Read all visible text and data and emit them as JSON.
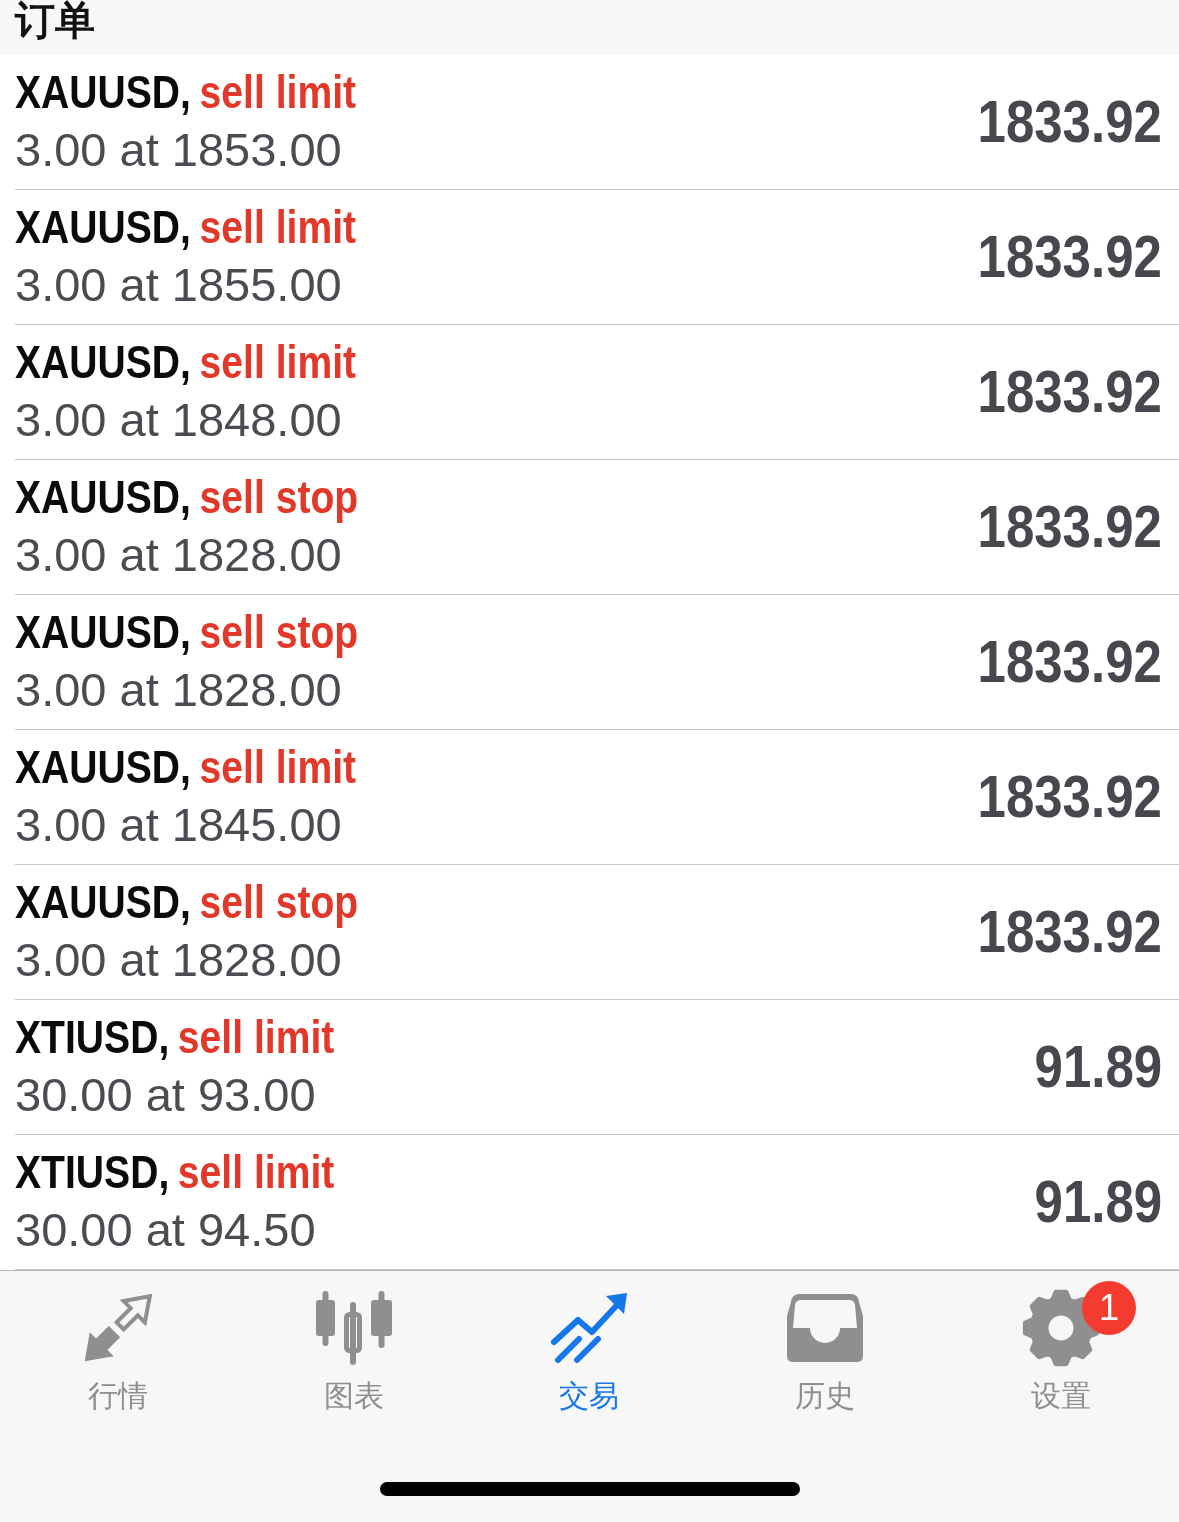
{
  "header": {
    "title": "订单"
  },
  "orders": [
    {
      "symbol": "XAUUSD,",
      "order_type": "sell limit",
      "details": "3.00 at 1853.00",
      "price": "1833.92"
    },
    {
      "symbol": "XAUUSD,",
      "order_type": "sell limit",
      "details": "3.00 at 1855.00",
      "price": "1833.92"
    },
    {
      "symbol": "XAUUSD,",
      "order_type": "sell limit",
      "details": "3.00 at 1848.00",
      "price": "1833.92"
    },
    {
      "symbol": "XAUUSD,",
      "order_type": "sell stop",
      "details": "3.00 at 1828.00",
      "price": "1833.92"
    },
    {
      "symbol": "XAUUSD,",
      "order_type": "sell stop",
      "details": "3.00 at 1828.00",
      "price": "1833.92"
    },
    {
      "symbol": "XAUUSD,",
      "order_type": "sell limit",
      "details": "3.00 at 1845.00",
      "price": "1833.92"
    },
    {
      "symbol": "XAUUSD,",
      "order_type": "sell stop",
      "details": "3.00 at 1828.00",
      "price": "1833.92"
    },
    {
      "symbol": "XTIUSD,",
      "order_type": "sell limit",
      "details": "30.00 at 93.00",
      "price": "91.89"
    },
    {
      "symbol": "XTIUSD,",
      "order_type": "sell limit",
      "details": "30.00 at 94.50",
      "price": "91.89"
    }
  ],
  "tab_bar": {
    "tabs": [
      {
        "kind": "quotes",
        "label": "行情",
        "selected": false
      },
      {
        "kind": "chart",
        "label": "图表",
        "selected": false
      },
      {
        "kind": "trade",
        "label": "交易",
        "selected": true
      },
      {
        "kind": "history",
        "label": "历史",
        "selected": false
      },
      {
        "kind": "settings",
        "label": "设置",
        "selected": false,
        "badge": "1"
      }
    ]
  }
}
